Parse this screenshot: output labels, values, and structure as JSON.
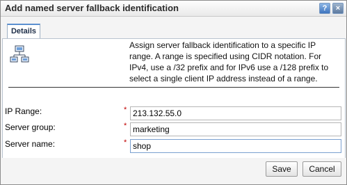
{
  "dialog": {
    "title": "Add named server fallback identification",
    "help_glyph": "?",
    "close_glyph": "×"
  },
  "tabs": [
    {
      "label": "Details",
      "active": true
    }
  ],
  "details": {
    "icon": "network-computers-icon",
    "description": "Assign server fallback identification to a specific IP range. A range is specified using CIDR notation. For IPv4, use a /32 prefix and for IPv6 use a /128 prefix to select a single client IP address instead of a range."
  },
  "form": {
    "required_mark": "*",
    "ip_range": {
      "label": "IP Range:",
      "value": "213.132.55.0"
    },
    "server_group": {
      "label": "Server group:",
      "value": "marketing"
    },
    "server_name": {
      "label": "Server name:",
      "value": "shop"
    }
  },
  "buttons": {
    "save": "Save",
    "cancel": "Cancel"
  },
  "colors": {
    "required": "#c00000",
    "tab_accent": "#5b8fd0",
    "title_button": "#3e75bf"
  }
}
